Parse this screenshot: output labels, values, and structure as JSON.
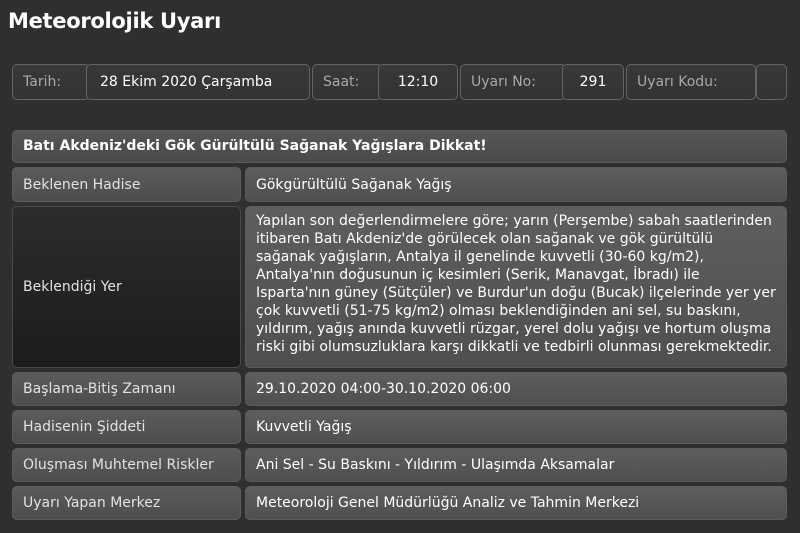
{
  "page": {
    "title": "Meteorolojik Uyarı"
  },
  "meta": {
    "date_label": "Tarih:",
    "date_value": "28 Ekim 2020 Çarşamba",
    "time_label": "Saat:",
    "time_value": "12:10",
    "warning_no_label": "Uyarı No:",
    "warning_no_value": "291",
    "warning_code_label": "Uyarı Kodu:",
    "warning_code_value": ""
  },
  "warning": {
    "headline": "Batı Akdeniz'deki Gök Gürültülü Sağanak Yağışlara Dikkat!",
    "rows": [
      {
        "label": "Beklenen Hadise",
        "value": "Gökgürültülü Sağanak Yağış"
      },
      {
        "label": "Beklendiği Yer",
        "value": "Yapılan son değerlendirmelere göre; yarın (Perşembe) sabah saatlerinden itibaren Batı Akdeniz'de görülecek olan sağanak ve gök gürültülü sağanak yağışların, Antalya il genelinde kuvvetli (30-60 kg/m2), Antalya'nın doğusunun iç kesimleri (Serik, Manavgat, İbradı) ile Isparta'nın güney (Sütçüler) ve Burdur'un doğu (Bucak) ilçelerinde yer yer çok kuvvetli (51-75 kg/m2) olması beklendiğinden ani sel, su baskını, yıldırım, yağış anında kuvvetli rüzgar, yerel dolu yağışı ve hortum oluşma riski gibi olumsuzluklara karşı dikkatli ve tedbirli olunması gerekmektedir."
      },
      {
        "label": "Başlama-Bitiş Zamanı",
        "value": "29.10.2020 04:00-30.10.2020 06:00"
      },
      {
        "label": "Hadisenin Şiddeti",
        "value": "Kuvvetli Yağış"
      },
      {
        "label": "Oluşması Muhtemel Riskler",
        "value": "Ani Sel - Su Baskını - Yıldırım - Ulaşımda Aksamalar"
      },
      {
        "label": "Uyarı Yapan Merkez",
        "value": "Meteoroloji Genel Müdürlüğü Analiz ve Tahmin Merkezi"
      }
    ]
  }
}
